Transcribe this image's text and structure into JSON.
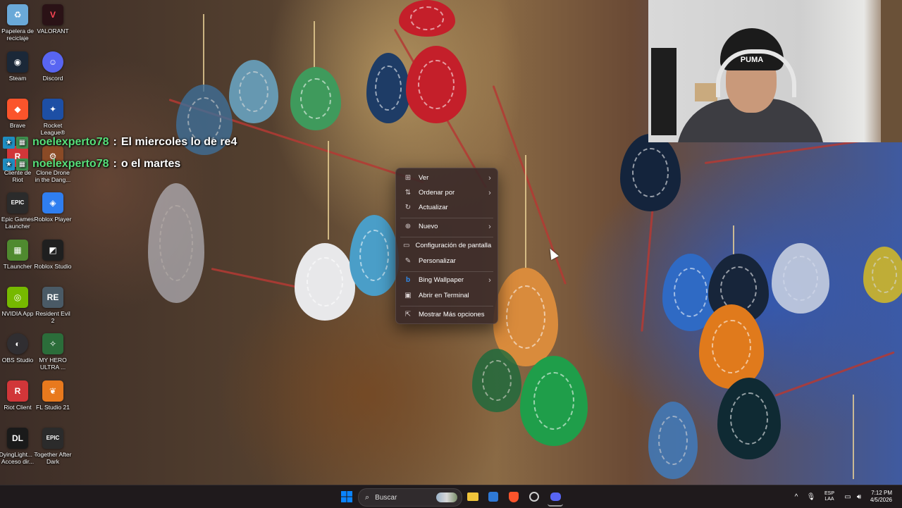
{
  "desktop": {
    "icons": [
      {
        "label": "Papelera de reciclaje",
        "icon": "recycle-bin-icon",
        "color": "#6aa9d8"
      },
      {
        "label": "VALORANT",
        "icon": "valorant-icon",
        "color": "#2a1216"
      },
      {
        "label": "Steam",
        "icon": "steam-icon",
        "color": "#1b2838"
      },
      {
        "label": "Discord",
        "icon": "discord-icon",
        "color": "#5865f2"
      },
      {
        "label": "Brave",
        "icon": "brave-icon",
        "color": "#fb542b"
      },
      {
        "label": "Rocket League®",
        "icon": "rocket-league-icon",
        "color": "#1d4fa5"
      },
      {
        "label": "Cliente de Riot",
        "icon": "riot-client-icon",
        "color": "#d13639"
      },
      {
        "label": "Clone Drone in the Dang...",
        "icon": "clone-drone-icon",
        "color": "#8a4a26"
      },
      {
        "label": "Epic Games Launcher",
        "icon": "epic-games-icon",
        "color": "#2b2b2b"
      },
      {
        "label": "Roblox Player",
        "icon": "roblox-player-icon",
        "color": "#2f7ef0"
      },
      {
        "label": "TLauncher",
        "icon": "tlauncher-icon",
        "color": "#4f8a2f"
      },
      {
        "label": "Roblox Studio",
        "icon": "roblox-studio-icon",
        "color": "#1f1f1f"
      },
      {
        "label": "NVIDIA App",
        "icon": "nvidia-icon",
        "color": "#76b900"
      },
      {
        "label": "Resident Evil 2",
        "icon": "resident-evil-icon",
        "color": "#4a5a66"
      },
      {
        "label": "OBS Studio",
        "icon": "obs-icon",
        "color": "#302e31"
      },
      {
        "label": "MY HERO ULTRA ...",
        "icon": "my-hero-icon",
        "color": "#2b6d3a"
      },
      {
        "label": "Riot Client",
        "icon": "riot-client-icon",
        "color": "#d13639"
      },
      {
        "label": "FL Studio 21",
        "icon": "fl-studio-icon",
        "color": "#e8791d"
      },
      {
        "label": "DyingLight... - Acceso dir...",
        "icon": "dying-light-icon",
        "color": "#1a1a1a"
      },
      {
        "label": "Together After Dark",
        "icon": "epic-games-icon",
        "color": "#2b2b2b"
      }
    ]
  },
  "chat": [
    {
      "user": "noelexperto78",
      "sep": ":",
      "message": "El miercoles lo de re4"
    },
    {
      "user": "noelexperto78",
      "sep": ":",
      "message": "o el martes"
    }
  ],
  "webcam": {
    "beanie_text": "PUMA"
  },
  "context_menu": {
    "items": [
      {
        "label": "Ver",
        "icon": "grid-icon",
        "glyph": "⊞",
        "arrow": "›"
      },
      {
        "label": "Ordenar por",
        "icon": "sort-icon",
        "glyph": "⇅",
        "arrow": "›"
      },
      {
        "label": "Actualizar",
        "icon": "refresh-icon",
        "glyph": "↻",
        "arrow": ""
      },
      {
        "label": "Nuevo",
        "icon": "new-icon",
        "glyph": "⊕",
        "arrow": "›"
      },
      {
        "label": "Configuración de pantalla",
        "icon": "display-icon",
        "glyph": "▭",
        "arrow": ""
      },
      {
        "label": "Personalizar",
        "icon": "brush-icon",
        "glyph": "✎",
        "arrow": ""
      },
      {
        "label": "Bing Wallpaper",
        "icon": "bing-icon",
        "glyph": "b",
        "arrow": "›"
      },
      {
        "label": "Abrir en Terminal",
        "icon": "terminal-icon",
        "glyph": "▣",
        "arrow": ""
      },
      {
        "label": "Mostrar Más opciones",
        "icon": "more-options-icon",
        "glyph": "⇱",
        "arrow": ""
      }
    ]
  },
  "taskbar": {
    "search_placeholder": "Buscar",
    "language": "ESP",
    "language_sub": "LAA",
    "time": "7:12 PM",
    "date": "4/5/2026",
    "accent": "#0a84ff"
  }
}
